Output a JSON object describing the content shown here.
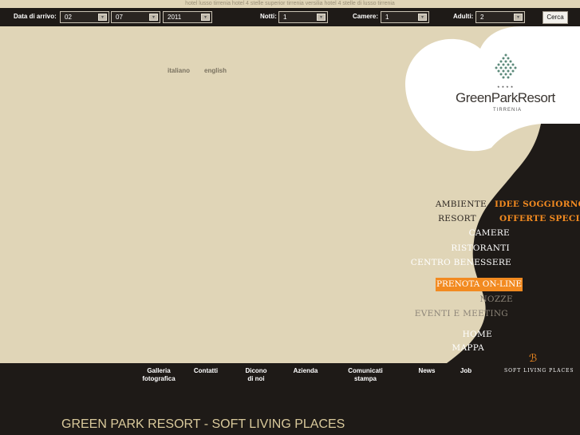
{
  "top_strip": {
    "text": "hotel lusso tirrenia hotel 4 stelle superior tirrenia versilia hotel 4 stelle di lusso tirrenia"
  },
  "booking": {
    "arrival_label": "Data di arrivo:",
    "day": "02",
    "month": "07",
    "year": "2011",
    "nights_label": "Notti:",
    "nights": "1",
    "rooms_label": "Camere:",
    "rooms": "1",
    "adults_label": "Adulti:",
    "adults": "2",
    "search_button": "Cerca"
  },
  "languages": {
    "italian": "italiano",
    "english": "english"
  },
  "logo": {
    "stars": "★★★★",
    "name": "GreenParkResort",
    "location": "TIRRENIA"
  },
  "nav_left": {
    "ambiente": "AMBIENTE",
    "resort": "RESORT",
    "camere": "CAMERE",
    "ristoranti": "RISTORANTI",
    "centro": "CENTRO BENESSERE",
    "prenota": "PRENOTA ON-LINE",
    "nozze": "NOZZE",
    "eventi": "EVENTI E MEETING",
    "home": "HOME",
    "mappa": "MAPPA"
  },
  "nav_right": {
    "idee": "IDEE SOGGIORNO",
    "offerte": "OFFERTE SPECIALI"
  },
  "bottom_nav": {
    "galleria_1": "Galleria",
    "galleria_2": "fotografica",
    "contatti": "Contatti",
    "dicono_1": "Dicono",
    "dicono_2": "di noi",
    "azienda": "Azienda",
    "comunicati_1": "Comunicati",
    "comunicati_2": "stampa",
    "news": "News",
    "job": "Job",
    "slp_mark": "ℬ",
    "slp": "SOFT LIVING PLACES"
  },
  "footer_title": "GREEN PARK RESORT - SOFT LIVING PLACES",
  "colors": {
    "beige": "#e0d5b7",
    "dark": "#1e1a17",
    "orange": "#f28a20"
  }
}
